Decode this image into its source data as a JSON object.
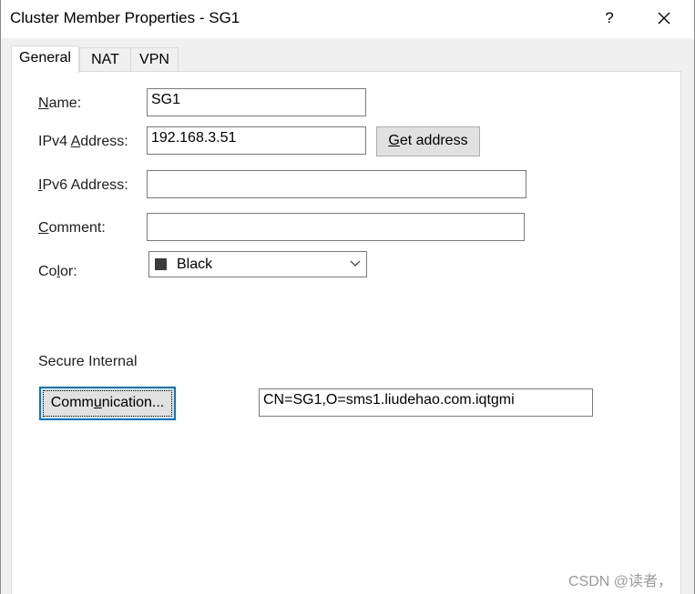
{
  "window": {
    "title": "Cluster Member Properties - SG1",
    "help_label": "?"
  },
  "tabs": [
    {
      "label": "General",
      "active": true
    },
    {
      "label": "NAT",
      "active": false
    },
    {
      "label": "VPN",
      "active": false
    }
  ],
  "form": {
    "name_label_access": "N",
    "name_label_rest": "ame:",
    "name_value": "SG1",
    "ipv4_label_pre": "IPv4 ",
    "ipv4_label_access": "A",
    "ipv4_label_rest": "ddress:",
    "ipv4_value": "192.168.3.51",
    "get_address_access": "G",
    "get_address_rest": "et address",
    "ipv6_label_access": "I",
    "ipv6_label_rest": "Pv6 Address:",
    "ipv6_value": "",
    "comment_label_access": "C",
    "comment_label_rest": "omment:",
    "comment_value": "",
    "color_label_pre": "Co",
    "color_label_access": "l",
    "color_label_rest": "or:",
    "color_value": "Black",
    "color_swatch": "#3c3c3c"
  },
  "sic": {
    "section_label": "Secure Internal",
    "communication_pre": "Comm",
    "communication_access": "u",
    "communication_rest": "nication...",
    "dn_value": "CN=SG1,O=sms1.liudehao.com.iqtgmi"
  },
  "watermark": "CSDN @读者，"
}
